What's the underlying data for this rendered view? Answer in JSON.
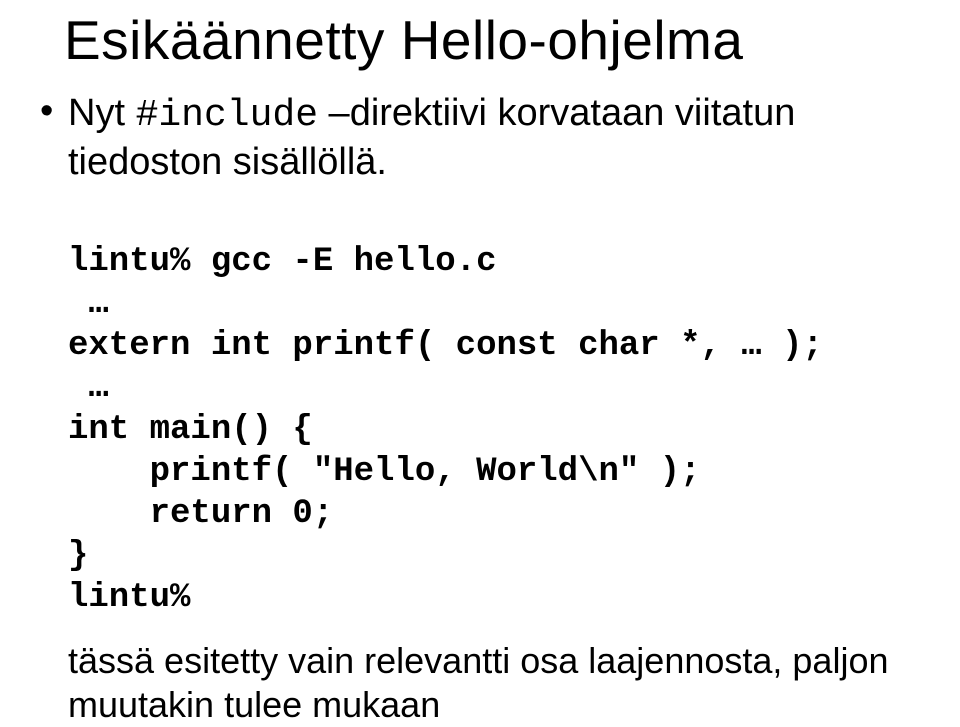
{
  "title": "Esikäännetty Hello-ohjelma",
  "bullet": {
    "dot": "•",
    "pre": "Nyt ",
    "code": "#include",
    "mid": " –direktiivi korvataan viitatun tiedoston sisällöllä."
  },
  "code": {
    "l1": "lintu% gcc -E hello.c",
    "l2": " …",
    "l3": "extern int printf( const char *, … );",
    "l4": " …",
    "l5": "int main() {",
    "l6": "    printf( \"Hello, World\\n\" );",
    "l7": "    return 0;",
    "l8": "}",
    "l9": "lintu%"
  },
  "footnote": "tässä esitetty vain relevantti osa laajennosta, paljon muutakin tulee mukaan"
}
